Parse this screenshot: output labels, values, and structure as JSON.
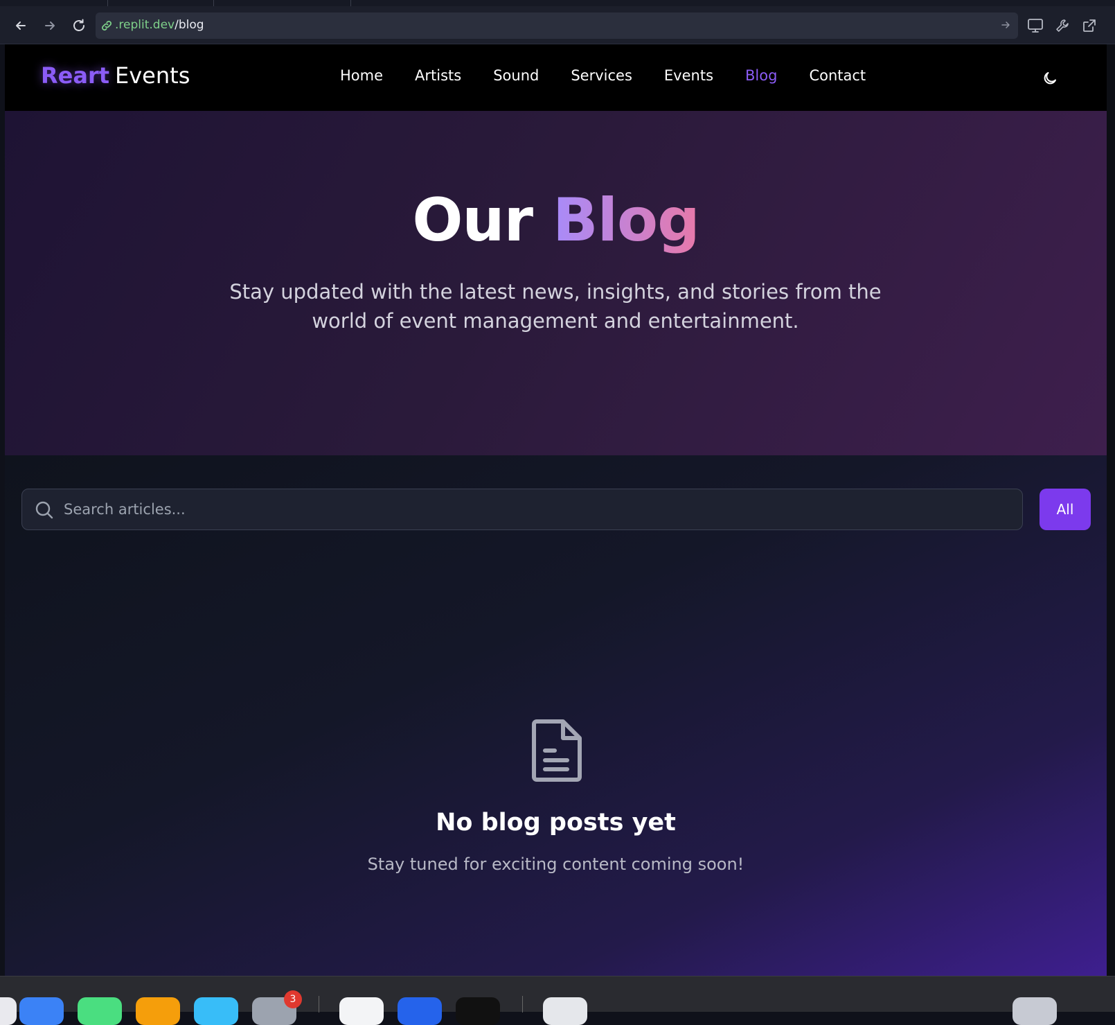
{
  "browser": {
    "url_host": ".replit.dev",
    "url_path": "/blog"
  },
  "site": {
    "logo_brand": "Reart",
    "logo_rest": "Events",
    "nav": [
      {
        "label": "Home",
        "active": false
      },
      {
        "label": "Artists",
        "active": false
      },
      {
        "label": "Sound",
        "active": false
      },
      {
        "label": "Services",
        "active": false
      },
      {
        "label": "Events",
        "active": false
      },
      {
        "label": "Blog",
        "active": true
      },
      {
        "label": "Contact",
        "active": false
      }
    ],
    "theme_toggle_icon": "moon-icon"
  },
  "hero": {
    "title_plain": "Our",
    "title_accent": "Blog",
    "subtitle": "Stay updated with the latest news, insights, and stories from the world of event management and entertainment."
  },
  "search": {
    "placeholder": "Search articles...",
    "value": "",
    "filter_label": "All"
  },
  "empty_state": {
    "icon": "document-icon",
    "title": "No blog posts yet",
    "subtitle": "Stay tuned for exciting content coming soon!"
  },
  "dock": {
    "badge_count": "3"
  },
  "colors": {
    "accent": "#8b5cf6",
    "button": "#7c3aed",
    "url_host": "#7fd18a"
  }
}
